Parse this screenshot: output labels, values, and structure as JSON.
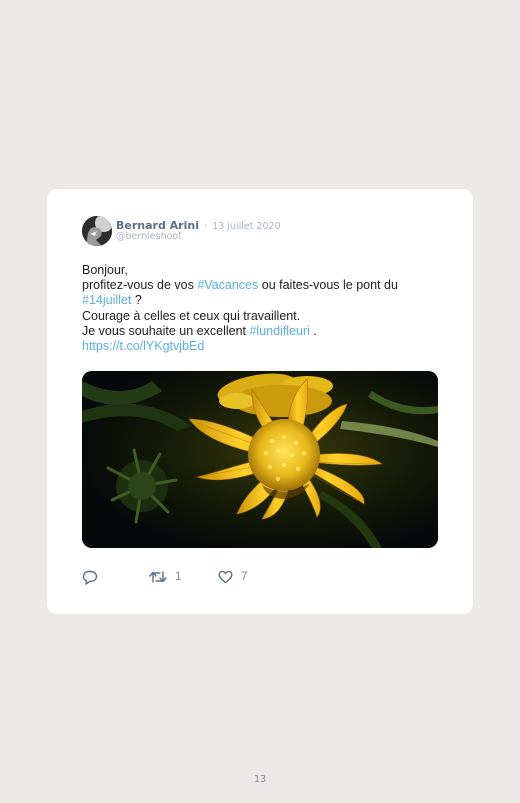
{
  "tweet": {
    "author_name": "Bernard Arini",
    "separator": "·",
    "date": "13 juillet 2020",
    "handle": "@bernieshoot",
    "lines": [
      [
        "Bonjour,"
      ],
      [
        "profitez-vous de vos ",
        "#Vacances",
        " ou faites-vous le pont du"
      ],
      [
        "#14juillet",
        " ?"
      ],
      [
        "Courage à celles et ceux qui travaillent."
      ],
      [
        "Je vous souhaite un excellent ",
        "#lundifleuri",
        " ."
      ],
      [
        "https://t.co/lYKgtvjbEd"
      ]
    ],
    "photo": "yellow flower photo",
    "retweet_count": "1",
    "like_count": "7"
  },
  "icons": {
    "reply": "reply-icon",
    "retweet": "retweet-icon",
    "like": "heart-icon",
    "avatar": "avatar-image"
  },
  "colors": {
    "background": "#ede8e8",
    "card": "#ffffff",
    "link": "#5aaee0",
    "name": "#5b6f86",
    "muted": "#a9b3bf",
    "icon": "#5b6f86"
  },
  "page": {
    "number": "13"
  }
}
